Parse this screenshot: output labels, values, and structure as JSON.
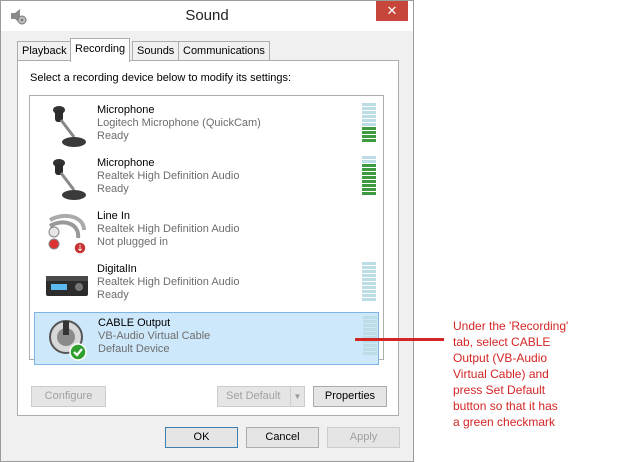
{
  "window": {
    "title": "Sound",
    "close_label": "✕"
  },
  "tabs": [
    {
      "label": "Playback"
    },
    {
      "label": "Recording",
      "active": true
    },
    {
      "label": "Sounds"
    },
    {
      "label": "Communications"
    }
  ],
  "instruction": "Select a recording device below to modify its settings:",
  "devices": [
    {
      "name": "Microphone",
      "desc": "Logitech Microphone (QuickCam)",
      "status": "Ready",
      "icon": "microphone-icon",
      "level": 0.42
    },
    {
      "name": "Microphone",
      "desc": "Realtek High Definition Audio",
      "status": "Ready",
      "icon": "microphone-icon",
      "level": 0.83
    },
    {
      "name": "Line In",
      "desc": "Realtek High Definition Audio",
      "status": "Not plugged in",
      "icon": "line-in-cable-icon",
      "level": null
    },
    {
      "name": "DigitalIn",
      "desc": "Realtek High Definition Audio",
      "status": "Ready",
      "icon": "digital-in-device-icon",
      "level": 0.0
    },
    {
      "name": "CABLE Output",
      "desc": "VB-Audio Virtual Cable",
      "status": "Default Device",
      "icon": "cable-output-icon",
      "level": 0.0,
      "selected": true,
      "default": true
    }
  ],
  "buttons": {
    "configure": "Configure",
    "set_default": "Set Default",
    "properties": "Properties",
    "ok": "OK",
    "cancel": "Cancel",
    "apply": "Apply"
  },
  "annotation": {
    "lines": [
      "Under the 'Recording'",
      "tab, select CABLE",
      "Output (VB-Audio",
      "Virtual Cable) and",
      "press Set Default",
      "button  so that it has",
      "a green checkmark"
    ]
  },
  "colors": {
    "annotation": "#d42525",
    "selection": "#cde8fb",
    "meter_on": "#3e9a3e",
    "meter_off": "#bcdde6",
    "close_button": "#c7463c"
  }
}
